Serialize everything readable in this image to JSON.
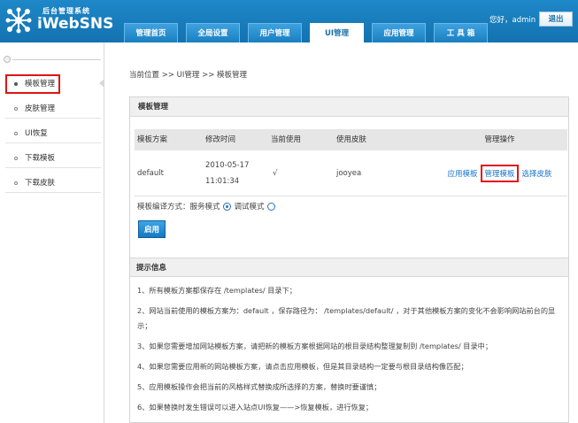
{
  "header": {
    "logo_sub": "后台管理系统",
    "logo_main": "iWebSNS",
    "nav": [
      "管理首页",
      "全局设置",
      "用户管理",
      "UI管理",
      "应用管理",
      "工 具 箱"
    ],
    "active_nav": "UI管理",
    "user_text": "您好，admin",
    "logout": "退出"
  },
  "sidebar": {
    "items": [
      "模板管理",
      "皮肤管理",
      "UI恢复",
      "下载模板",
      "下载皮肤"
    ],
    "active": "模板管理"
  },
  "breadcrumb": "当前位置 >> UI管理 >> 模板管理",
  "panel": {
    "title": "模板管理",
    "columns": [
      "模板方案",
      "修改时间",
      "当前使用",
      "使用皮肤",
      "管理操作"
    ],
    "row": {
      "scheme": "default",
      "date": "2010-05-17",
      "time": "11:01:34",
      "in_use": "√",
      "skin": "jooyea",
      "ops": [
        "应用模板",
        "管理模板",
        "选择皮肤"
      ]
    },
    "compile_label": "模板编译方式：服务模式",
    "debug_label": "调试模式",
    "apply_button": "启用"
  },
  "tips": {
    "title": "提示信息",
    "items": [
      "1、所有模板方案都保存在 /templates/ 目录下；",
      "2、网站当前使用的模板方案为：default ，保存路径为： /templates/default/ ，对于其他模板方案的变化不会影响网站前台的显示；",
      "3、如果您需要增加网站模板方案，请把新的模板方案根据网站的根目录结构整理复制到 /templates/ 目录中；",
      "4、如果您需要应用新的网站模板方案，请点击应用模板，但是其目录结构一定要与根目录结构像匹配；",
      "5、应用模板操作会把当前的风格样式替换成所选择的方案，替换时要谨慎；",
      "6、如果替换时发生错误可以进入站点UI恢复——>恢复模板，进行恢复；"
    ]
  }
}
